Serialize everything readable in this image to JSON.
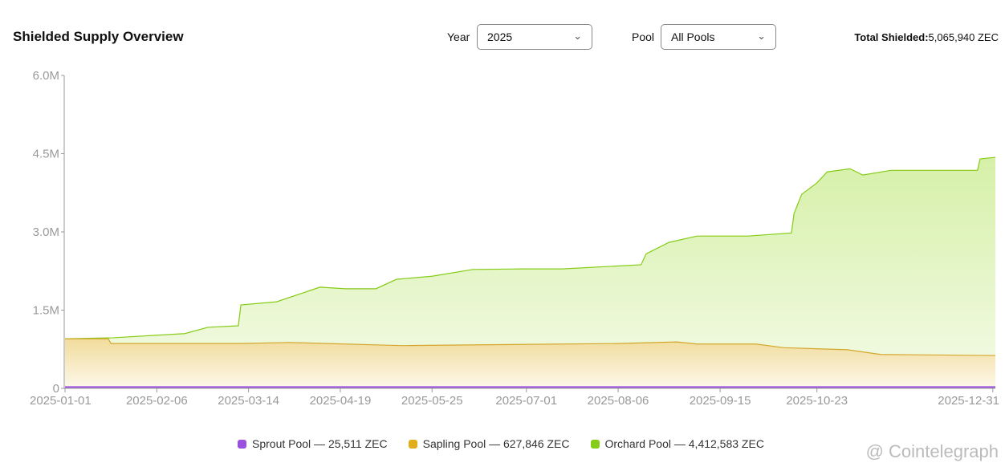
{
  "header": {
    "title": "Shielded Supply Overview",
    "year_label": "Year",
    "year_value": "2025",
    "pool_label": "Pool",
    "pool_value": "All Pools",
    "total_label": "Total Shielded:",
    "total_value": "5,065,940 ZEC"
  },
  "watermark": "@ Cointelegraph",
  "colors": {
    "sprout": "#9b51e0",
    "sapling": "#e2ae1c",
    "orchard": "#84cc16"
  },
  "chart_data": {
    "type": "area",
    "title": "Shielded Supply Overview",
    "ylim": [
      0,
      6000000
    ],
    "y_ticks": [
      {
        "v": 0,
        "label": "0"
      },
      {
        "v": 1500000,
        "label": "1.5M"
      },
      {
        "v": 3000000,
        "label": "3.0M"
      },
      {
        "v": 4500000,
        "label": "4.5M"
      },
      {
        "v": 6000000,
        "label": "6.0M"
      }
    ],
    "x_range_days": [
      0,
      365
    ],
    "x_ticks": [
      {
        "d": 0,
        "label": "2025-01-01"
      },
      {
        "d": 36,
        "label": "2025-02-06"
      },
      {
        "d": 72,
        "label": "2025-03-14"
      },
      {
        "d": 108,
        "label": "2025-04-19"
      },
      {
        "d": 144,
        "label": "2025-05-25"
      },
      {
        "d": 181,
        "label": "2025-07-01"
      },
      {
        "d": 217,
        "label": "2025-08-06"
      },
      {
        "d": 257,
        "label": "2025-09-15"
      },
      {
        "d": 295,
        "label": "2025-10-23"
      },
      {
        "d": 364,
        "label": "2025-12-31"
      }
    ],
    "series": [
      {
        "name": "Orchard Pool",
        "legend": "Orchard Pool — 4,412,583 ZEC",
        "color": "#84cc16",
        "days": [
          0,
          19,
          47,
          56,
          68,
          69,
          83,
          100,
          110,
          122,
          130,
          144,
          160,
          179,
          195,
          226,
          228,
          237,
          248,
          268,
          285,
          286,
          289,
          295,
          299,
          308,
          313,
          324,
          343,
          358,
          359,
          365
        ],
        "values": [
          950000,
          970000,
          1050000,
          1170000,
          1200000,
          1600000,
          1660000,
          1940000,
          1910000,
          1910000,
          2090000,
          2150000,
          2280000,
          2290000,
          2290000,
          2370000,
          2580000,
          2800000,
          2920000,
          2920000,
          2980000,
          3350000,
          3720000,
          3940000,
          4150000,
          4210000,
          4090000,
          4180000,
          4180000,
          4180000,
          4400000,
          4430000
        ]
      },
      {
        "name": "Sapling Pool",
        "legend": "Sapling Pool — 627,846 ZEC",
        "color": "#e2ae1c",
        "days": [
          0,
          17,
          18,
          69,
          88,
          132,
          217,
          240,
          248,
          271,
          282,
          307,
          320,
          365
        ],
        "values": [
          950000,
          950000,
          860000,
          860000,
          880000,
          820000,
          860000,
          890000,
          850000,
          850000,
          780000,
          740000,
          650000,
          630000
        ],
        "fill": true
      },
      {
        "name": "Sprout Pool",
        "legend": "Sprout Pool — 25,511 ZEC",
        "color": "#9b51e0",
        "days": [
          0,
          365
        ],
        "values": [
          25511,
          25511
        ]
      }
    ]
  }
}
